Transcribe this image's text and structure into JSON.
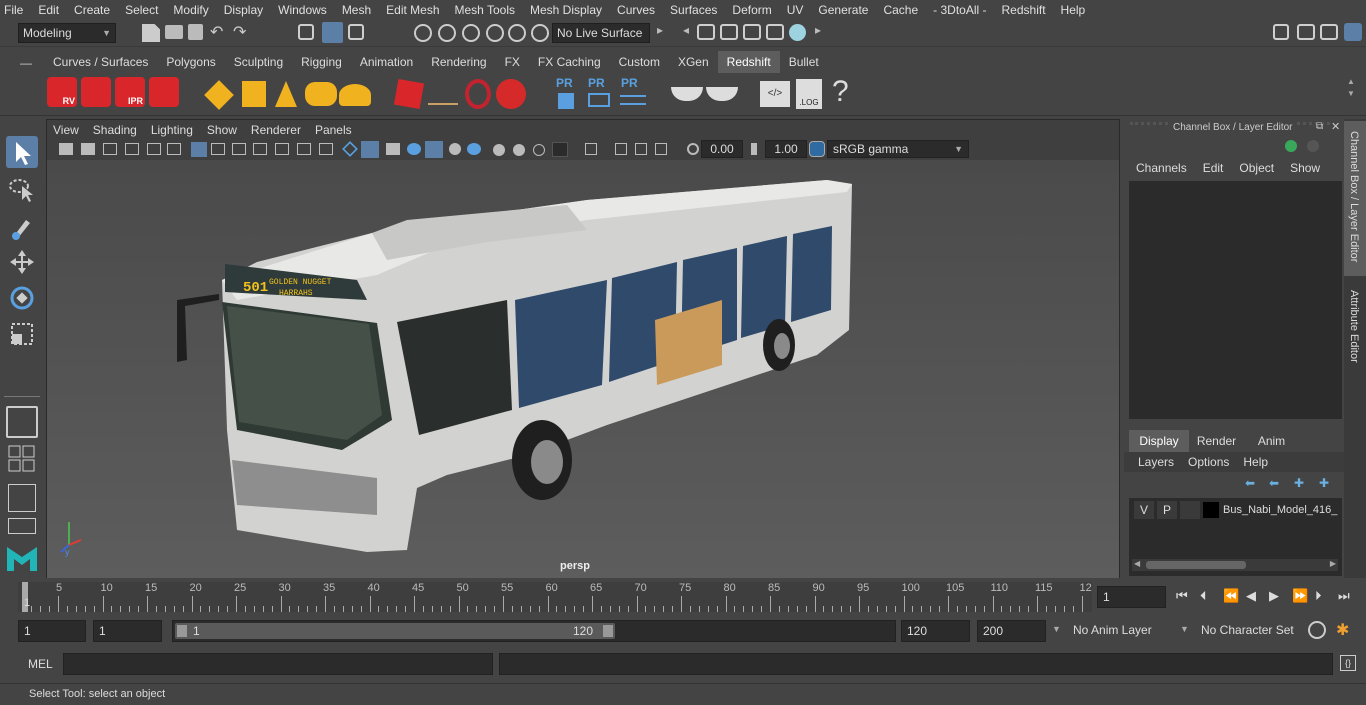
{
  "menu": [
    "File",
    "Edit",
    "Create",
    "Select",
    "Modify",
    "Display",
    "Windows",
    "Mesh",
    "Edit Mesh",
    "Mesh Tools",
    "Mesh Display",
    "Curves",
    "Surfaces",
    "Deform",
    "UV",
    "Generate",
    "Cache",
    "- 3DtoAll -",
    "Redshift",
    "Help"
  ],
  "workspace": "Modeling",
  "live_surface": "No Live Surface",
  "shelf_tabs": [
    "Curves / Surfaces",
    "Polygons",
    "Sculpting",
    "Rigging",
    "Animation",
    "Rendering",
    "FX",
    "FX Caching",
    "Custom",
    "XGen",
    "Redshift",
    "Bullet"
  ],
  "active_tab": "Redshift",
  "shelf_labels": {
    "rv": "RV",
    "ipr": "IPR",
    "pr": "PR",
    "log": ".LOG",
    "help": "?"
  },
  "viewport": {
    "menu": [
      "View",
      "Shading",
      "Lighting",
      "Show",
      "Renderer",
      "Panels"
    ],
    "exposure": "0.00",
    "gamma": "1.00",
    "colorspace": "sRGB gamma",
    "camera": "persp",
    "bus_sign_number": "501",
    "bus_sign_line1": "GOLDEN NUGGET",
    "bus_sign_line2": "HARRAHS"
  },
  "channel_box": {
    "title": "Channel Box / Layer Editor",
    "menu": [
      "Channels",
      "Edit",
      "Object",
      "Show"
    ],
    "layer_tabs": [
      "Display",
      "Render",
      "Anim"
    ],
    "layer_menu": [
      "Layers",
      "Options",
      "Help"
    ],
    "layer": {
      "v": "V",
      "p": "P",
      "name": "Bus_Nabi_Model_416_"
    }
  },
  "side_tabs": [
    "Channel Box / Layer Editor",
    "Attribute Editor"
  ],
  "timeline": {
    "ticks": [
      "5",
      "10",
      "15",
      "20",
      "25",
      "30",
      "35",
      "40",
      "45",
      "50",
      "55",
      "60",
      "65",
      "70",
      "75",
      "80",
      "85",
      "90",
      "95",
      "100",
      "105",
      "110",
      "115",
      "12"
    ],
    "start_marker": "1",
    "current": "1"
  },
  "range": {
    "start": "1",
    "start2": "1",
    "slider_start": "1",
    "slider_end": "120",
    "end": "120",
    "end2": "200",
    "anim_layer": "No Anim Layer",
    "char_set": "No Character Set"
  },
  "cmd": {
    "label": "MEL"
  },
  "status": "Select Tool: select an object"
}
